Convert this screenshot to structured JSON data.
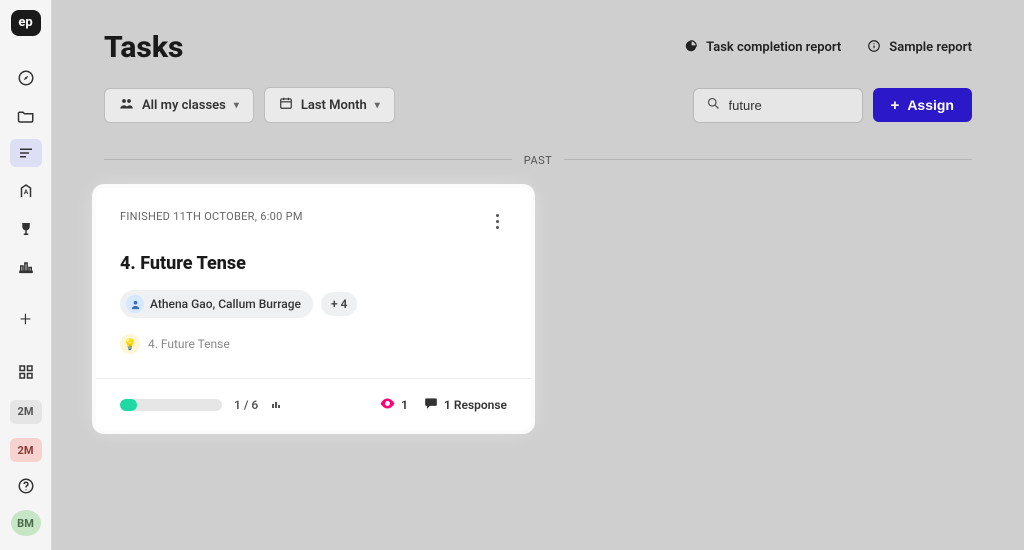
{
  "logo": "ep",
  "sidebar": {
    "badge1": "2M",
    "badge2": "2M",
    "avatar": "BM"
  },
  "header": {
    "title": "Tasks",
    "completion_report": "Task completion report",
    "sample_report": "Sample report"
  },
  "filters": {
    "classes": "All my classes",
    "period": "Last Month"
  },
  "search": {
    "value": "future"
  },
  "assign_label": "Assign",
  "divider": "PAST",
  "card": {
    "finished": "FINISHED 11TH OCTOBER, 6:00 PM",
    "title": "4. Future Tense",
    "assignees": "Athena Gao, Callum Burrage",
    "more_count": "+ 4",
    "topic": "4. Future Tense",
    "progress_label": "1 / 6",
    "views": "1",
    "responses": "1 Response",
    "progress_pct": 17
  }
}
